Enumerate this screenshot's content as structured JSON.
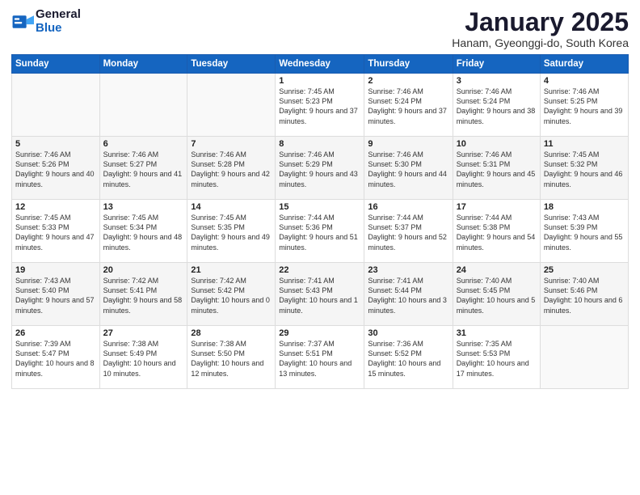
{
  "header": {
    "logo_general": "General",
    "logo_blue": "Blue",
    "title": "January 2025",
    "subtitle": "Hanam, Gyeonggi-do, South Korea"
  },
  "weekdays": [
    "Sunday",
    "Monday",
    "Tuesday",
    "Wednesday",
    "Thursday",
    "Friday",
    "Saturday"
  ],
  "weeks": [
    [
      {
        "day": "",
        "info": ""
      },
      {
        "day": "",
        "info": ""
      },
      {
        "day": "",
        "info": ""
      },
      {
        "day": "1",
        "info": "Sunrise: 7:45 AM\nSunset: 5:23 PM\nDaylight: 9 hours and 37 minutes."
      },
      {
        "day": "2",
        "info": "Sunrise: 7:46 AM\nSunset: 5:24 PM\nDaylight: 9 hours and 37 minutes."
      },
      {
        "day": "3",
        "info": "Sunrise: 7:46 AM\nSunset: 5:24 PM\nDaylight: 9 hours and 38 minutes."
      },
      {
        "day": "4",
        "info": "Sunrise: 7:46 AM\nSunset: 5:25 PM\nDaylight: 9 hours and 39 minutes."
      }
    ],
    [
      {
        "day": "5",
        "info": "Sunrise: 7:46 AM\nSunset: 5:26 PM\nDaylight: 9 hours and 40 minutes."
      },
      {
        "day": "6",
        "info": "Sunrise: 7:46 AM\nSunset: 5:27 PM\nDaylight: 9 hours and 41 minutes."
      },
      {
        "day": "7",
        "info": "Sunrise: 7:46 AM\nSunset: 5:28 PM\nDaylight: 9 hours and 42 minutes."
      },
      {
        "day": "8",
        "info": "Sunrise: 7:46 AM\nSunset: 5:29 PM\nDaylight: 9 hours and 43 minutes."
      },
      {
        "day": "9",
        "info": "Sunrise: 7:46 AM\nSunset: 5:30 PM\nDaylight: 9 hours and 44 minutes."
      },
      {
        "day": "10",
        "info": "Sunrise: 7:46 AM\nSunset: 5:31 PM\nDaylight: 9 hours and 45 minutes."
      },
      {
        "day": "11",
        "info": "Sunrise: 7:45 AM\nSunset: 5:32 PM\nDaylight: 9 hours and 46 minutes."
      }
    ],
    [
      {
        "day": "12",
        "info": "Sunrise: 7:45 AM\nSunset: 5:33 PM\nDaylight: 9 hours and 47 minutes."
      },
      {
        "day": "13",
        "info": "Sunrise: 7:45 AM\nSunset: 5:34 PM\nDaylight: 9 hours and 48 minutes."
      },
      {
        "day": "14",
        "info": "Sunrise: 7:45 AM\nSunset: 5:35 PM\nDaylight: 9 hours and 49 minutes."
      },
      {
        "day": "15",
        "info": "Sunrise: 7:44 AM\nSunset: 5:36 PM\nDaylight: 9 hours and 51 minutes."
      },
      {
        "day": "16",
        "info": "Sunrise: 7:44 AM\nSunset: 5:37 PM\nDaylight: 9 hours and 52 minutes."
      },
      {
        "day": "17",
        "info": "Sunrise: 7:44 AM\nSunset: 5:38 PM\nDaylight: 9 hours and 54 minutes."
      },
      {
        "day": "18",
        "info": "Sunrise: 7:43 AM\nSunset: 5:39 PM\nDaylight: 9 hours and 55 minutes."
      }
    ],
    [
      {
        "day": "19",
        "info": "Sunrise: 7:43 AM\nSunset: 5:40 PM\nDaylight: 9 hours and 57 minutes."
      },
      {
        "day": "20",
        "info": "Sunrise: 7:42 AM\nSunset: 5:41 PM\nDaylight: 9 hours and 58 minutes."
      },
      {
        "day": "21",
        "info": "Sunrise: 7:42 AM\nSunset: 5:42 PM\nDaylight: 10 hours and 0 minutes."
      },
      {
        "day": "22",
        "info": "Sunrise: 7:41 AM\nSunset: 5:43 PM\nDaylight: 10 hours and 1 minute."
      },
      {
        "day": "23",
        "info": "Sunrise: 7:41 AM\nSunset: 5:44 PM\nDaylight: 10 hours and 3 minutes."
      },
      {
        "day": "24",
        "info": "Sunrise: 7:40 AM\nSunset: 5:45 PM\nDaylight: 10 hours and 5 minutes."
      },
      {
        "day": "25",
        "info": "Sunrise: 7:40 AM\nSunset: 5:46 PM\nDaylight: 10 hours and 6 minutes."
      }
    ],
    [
      {
        "day": "26",
        "info": "Sunrise: 7:39 AM\nSunset: 5:47 PM\nDaylight: 10 hours and 8 minutes."
      },
      {
        "day": "27",
        "info": "Sunrise: 7:38 AM\nSunset: 5:49 PM\nDaylight: 10 hours and 10 minutes."
      },
      {
        "day": "28",
        "info": "Sunrise: 7:38 AM\nSunset: 5:50 PM\nDaylight: 10 hours and 12 minutes."
      },
      {
        "day": "29",
        "info": "Sunrise: 7:37 AM\nSunset: 5:51 PM\nDaylight: 10 hours and 13 minutes."
      },
      {
        "day": "30",
        "info": "Sunrise: 7:36 AM\nSunset: 5:52 PM\nDaylight: 10 hours and 15 minutes."
      },
      {
        "day": "31",
        "info": "Sunrise: 7:35 AM\nSunset: 5:53 PM\nDaylight: 10 hours and 17 minutes."
      },
      {
        "day": "",
        "info": ""
      }
    ]
  ]
}
